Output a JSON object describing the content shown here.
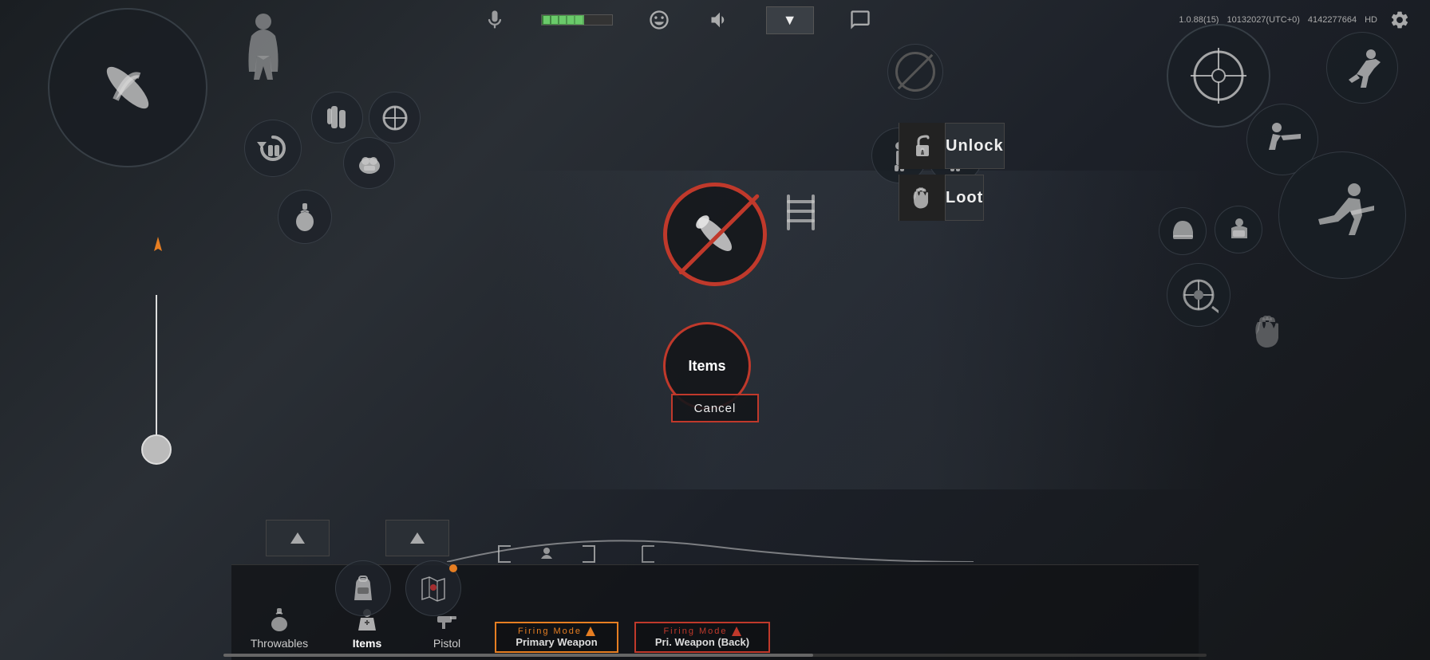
{
  "app": {
    "version": "1.0.88(15)",
    "session": "10132027(UTC+0)",
    "player_id": "4142277664",
    "quality": "HD"
  },
  "top_bar": {
    "mic_label": "mic",
    "emote_label": "emote",
    "volume_label": "volume",
    "chat_label": "chat",
    "settings_label": "settings",
    "dropdown_label": "▼"
  },
  "center_dialog": {
    "bullet_icon": "bullet-no-entry",
    "items_label": "Items",
    "cancel_label": "Cancel",
    "action_buttons": [
      {
        "id": "unlock",
        "label": "Unlock",
        "icon": "lock-icon"
      },
      {
        "id": "loot",
        "label": "Loot",
        "icon": "hand-icon"
      }
    ]
  },
  "bottom_nav": {
    "tabs": [
      {
        "id": "throwables",
        "label": "Throwables",
        "active": false,
        "icon": "grenade-icon"
      },
      {
        "id": "items",
        "label": "Items",
        "active": true,
        "icon": "backpack-icon"
      },
      {
        "id": "pistol",
        "label": "Pistol",
        "active": false,
        "icon": "pistol-icon"
      },
      {
        "id": "primary_weapon",
        "label": "Primary Weapon",
        "active": false,
        "icon": "rifle-icon"
      },
      {
        "id": "pri_weapon_back",
        "label": "Pri. Weapon (Back)",
        "active": false,
        "icon": "rifle-back-icon"
      }
    ]
  },
  "firing_mode_cards": [
    {
      "id": "primary_firing",
      "title": "Firing Mode",
      "subtitle": "Primary Weapon",
      "style": "orange"
    },
    {
      "id": "secondary_firing",
      "title": "Firing Mode",
      "subtitle": "Pri. Weapon (Back)",
      "style": "red",
      "selected": true
    }
  ],
  "icons": {
    "bullet": "⊘",
    "lock": "🔒",
    "hand": "🤝",
    "gear": "⚙",
    "chevron_down": "▾",
    "mic": "🎤",
    "chat": "💬",
    "volume": "🔊",
    "smiley": "😊"
  }
}
